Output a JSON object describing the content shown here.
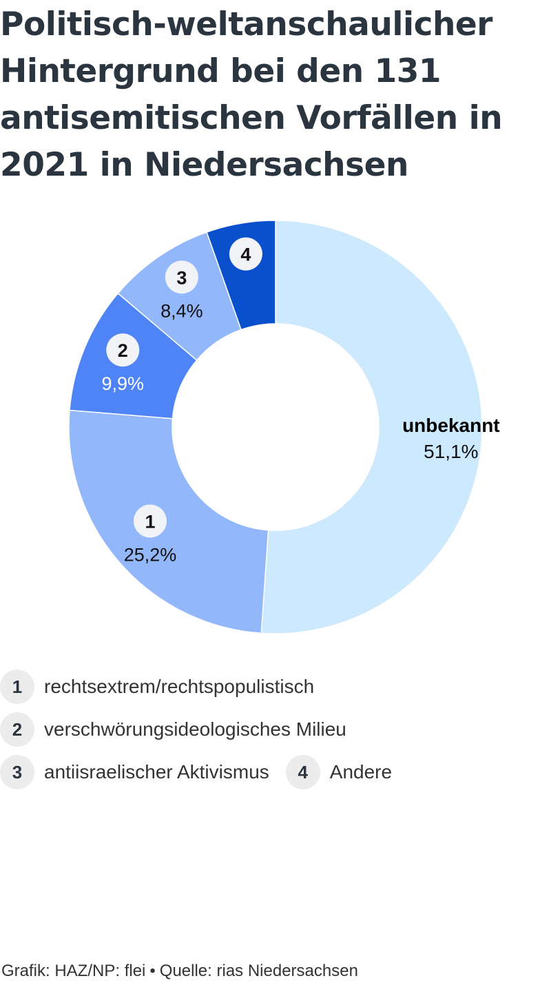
{
  "title": "Politisch-weltanschaulicher Hintergrund bei den 131 antisemitischen Vorfällen in 2021 in Niedersachsen",
  "chart_data": {
    "type": "pie",
    "variant": "donut",
    "title": "Politisch-weltanschaulicher Hintergrund bei den 131 antisemitischen Vorfällen in 2021 in Niedersachsen",
    "slices": [
      {
        "key": "unbekannt",
        "marker": "",
        "label": "unbekannt",
        "value": 51.1,
        "value_label": "51,1%",
        "color": "#cde9fd"
      },
      {
        "key": "1",
        "marker": "1",
        "label": "rechtsextrem/rechtspopulistisch",
        "value": 25.2,
        "value_label": "25,2%",
        "color": "#93b7fb"
      },
      {
        "key": "2",
        "marker": "2",
        "label": "verschwörungsideologisches Milieu",
        "value": 9.9,
        "value_label": "9,9%",
        "color": "#4f84f7"
      },
      {
        "key": "3",
        "marker": "3",
        "label": "antiisraelischer Aktivismus",
        "value": 8.4,
        "value_label": "8,4%",
        "color": "#93b7fb"
      },
      {
        "key": "4",
        "marker": "4",
        "label": "Andere",
        "value": 5.4,
        "value_label": "",
        "color": "#0a4fcc"
      }
    ],
    "unit": "%",
    "legend_placement": "bottom"
  },
  "legend": [
    {
      "num": "1",
      "label": "rechtsextrem/rechtspopulistisch"
    },
    {
      "num": "2",
      "label": "verschwörungsideologisches Milieu"
    },
    {
      "num": "3",
      "label": "antiisraelischer Aktivismus"
    },
    {
      "num": "4",
      "label": "Andere"
    }
  ],
  "footer": {
    "grafik": "Grafik: HAZ/NP: flei",
    "separator": "•",
    "quelle": "Quelle: rias Niedersachsen"
  }
}
